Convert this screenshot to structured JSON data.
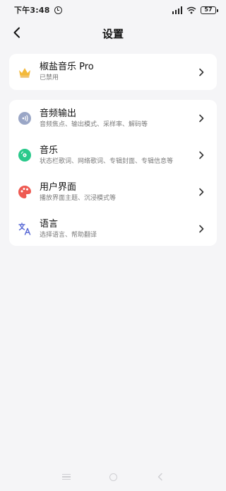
{
  "status_bar": {
    "time": "下午3:48",
    "battery": "57"
  },
  "header": {
    "title": "设置"
  },
  "pro_card": {
    "title": "椒盐音乐 Pro",
    "subtitle": "已禁用"
  },
  "settings": [
    {
      "title": "音频输出",
      "subtitle": "音频焦点、输出模式、采样率、解码等",
      "icon": "audio-output-icon",
      "color": "#9aa6c6"
    },
    {
      "title": "音乐",
      "subtitle": "状态栏歌词、网络歌词、专辑封面、专辑信息等",
      "icon": "music-disc-icon",
      "color": "#29c98b"
    },
    {
      "title": "用户界面",
      "subtitle": "播放界面主题、沉浸模式等",
      "icon": "palette-icon",
      "color": "#ee5a52"
    },
    {
      "title": "语言",
      "subtitle": "选择语言、帮助翻译",
      "icon": "translate-icon",
      "color": "#5b6bd6"
    }
  ],
  "colors": {
    "background": "#f5f5f7",
    "card": "#ffffff",
    "crown": "#f3b93a"
  }
}
